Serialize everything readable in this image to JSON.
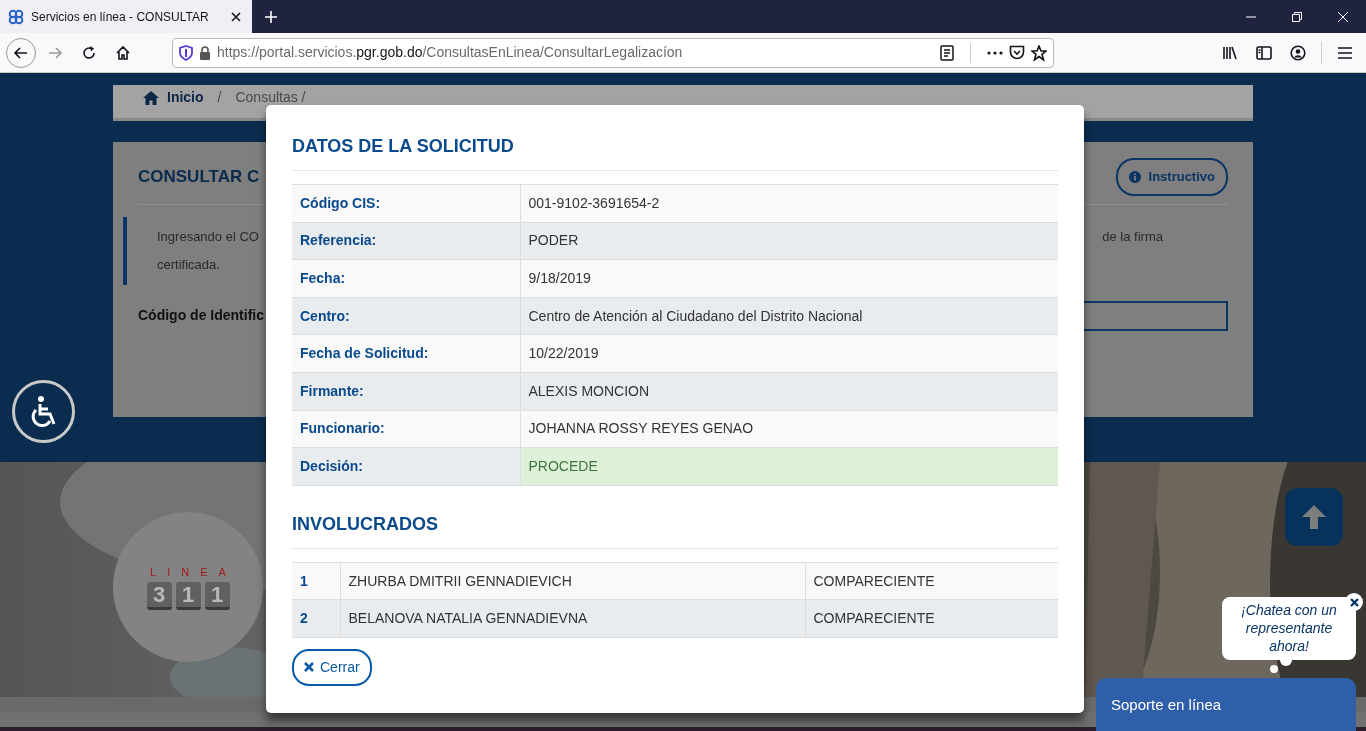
{
  "browser": {
    "tab_title": "Servicios en línea - CONSULTAR",
    "url": "https://portal.servicios.**pgr.gob.do**/ConsultasEnLinea/ConsultarLegalizacíon"
  },
  "breadcrumb": {
    "home": "Inicio",
    "separator": "/",
    "current": "Consultas /"
  },
  "page": {
    "title": "CONSULTAR C",
    "instructivo_button": "Instructivo",
    "intro_start": "Ingresando el CO",
    "intro_end": "de la firma",
    "intro_line2": "certificada.",
    "field_label": "Código de Identific"
  },
  "promo": {
    "logo_word": "LINEA",
    "logo_keys": [
      "3",
      "1",
      "1"
    ]
  },
  "modal": {
    "title": "DATOS DE LA SOLICITUD",
    "details": [
      {
        "label": "Código CIS:",
        "value": "001-9102-3691654-2"
      },
      {
        "label": "Referencia:",
        "value": "PODER"
      },
      {
        "label": "Fecha:",
        "value": "9/18/2019"
      },
      {
        "label": "Centro:",
        "value": "Centro de Atención al Ciudadano del Distrito Nacional"
      },
      {
        "label": "Fecha de Solicitud:",
        "value": "10/22/2019"
      },
      {
        "label": "Firmante:",
        "value": "ALEXIS MONCION"
      },
      {
        "label": "Funcionario:",
        "value": "JOHANNA ROSSY REYES GENAO"
      },
      {
        "label": "Decisión:",
        "value": "PROCEDE",
        "highlighted": true
      }
    ],
    "involved_title": "INVOLUCRADOS",
    "involved": [
      {
        "number": "1",
        "name": "ZHURBA DMITRII GENNADIEVICH",
        "role": "COMPARECIENTE"
      },
      {
        "number": "2",
        "name": "BELANOVA NATALIA GENNADIEVNA",
        "role": "COMPARECIENTE"
      }
    ],
    "close_button": "Cerrar"
  },
  "chat": {
    "bubble": "¡Chatea con un representante ahora!",
    "support_bar": "Soporte en línea"
  }
}
